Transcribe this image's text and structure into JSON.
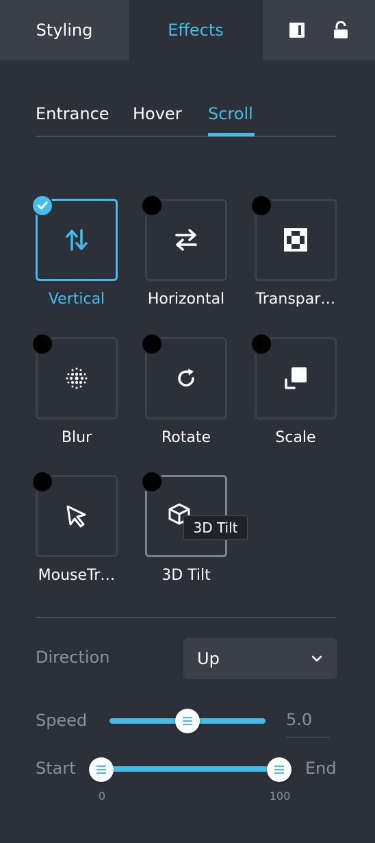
{
  "top_tabs": {
    "styling": "Styling",
    "effects": "Effects"
  },
  "sub_tabs": {
    "entrance": "Entrance",
    "hover": "Hover",
    "scroll": "Scroll"
  },
  "effects": [
    {
      "label": "Vertical",
      "icon": "vertical-arrows-icon",
      "selected": true
    },
    {
      "label": "Horizontal",
      "icon": "horizontal-arrows-icon",
      "selected": false
    },
    {
      "label": "Transpar…",
      "icon": "checker-icon",
      "selected": false
    },
    {
      "label": "Blur",
      "icon": "blur-dots-icon",
      "selected": false
    },
    {
      "label": "Rotate",
      "icon": "rotate-icon",
      "selected": false
    },
    {
      "label": "Scale",
      "icon": "scale-icon",
      "selected": false
    },
    {
      "label": "MouseTr…",
      "icon": "cursor-icon",
      "selected": false
    },
    {
      "label": "3D Tilt",
      "icon": "cube-icon",
      "selected": false
    }
  ],
  "tooltip": "3D Tilt",
  "direction": {
    "label": "Direction",
    "value": "Up"
  },
  "speed": {
    "label": "Speed",
    "value": "5.0",
    "fraction": 0.5
  },
  "range": {
    "start_label": "Start",
    "end_label": "End",
    "min": "0",
    "max": "100",
    "start_value": 0,
    "end_value": 100
  },
  "colors": {
    "accent": "#44bde8",
    "background": "#2c3039",
    "panel": "#3a3f49"
  }
}
